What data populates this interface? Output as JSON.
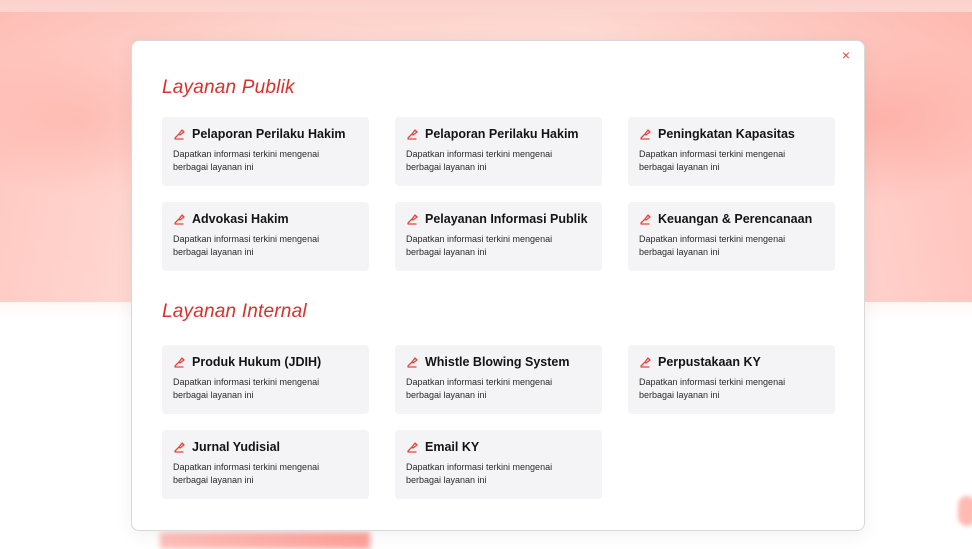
{
  "modal": {
    "close_label": "×",
    "accent_color": "#d8302a"
  },
  "sections": [
    {
      "title": "Layanan Publik",
      "cards": [
        {
          "title": "Pelaporan Perilaku Hakim",
          "desc": "Dapatkan informasi terkini mengenai berbagai layanan ini",
          "icon": "service-icon"
        },
        {
          "title": "Pelaporan Perilaku Hakim",
          "desc": "Dapatkan informasi terkini mengenai berbagai layanan ini",
          "icon": "service-icon"
        },
        {
          "title": "Peningkatan Kapasitas",
          "desc": "Dapatkan informasi terkini mengenai berbagai layanan ini",
          "icon": "service-icon"
        },
        {
          "title": "Advokasi Hakim",
          "desc": "Dapatkan informasi terkini mengenai berbagai layanan ini",
          "icon": "service-icon"
        },
        {
          "title": "Pelayanan Informasi Publik",
          "desc": "Dapatkan informasi terkini mengenai berbagai layanan ini",
          "icon": "service-icon"
        },
        {
          "title": "Keuangan & Perencanaan",
          "desc": "Dapatkan informasi terkini mengenai berbagai layanan ini",
          "icon": "service-icon"
        }
      ]
    },
    {
      "title": "Layanan Internal",
      "cards": [
        {
          "title": "Produk Hukum (JDIH)",
          "desc": "Dapatkan informasi terkini mengenai berbagai layanan ini",
          "icon": "service-icon"
        },
        {
          "title": "Whistle Blowing System",
          "desc": "Dapatkan informasi terkini mengenai berbagai layanan ini",
          "icon": "service-icon"
        },
        {
          "title": "Perpustakaan KY",
          "desc": "Dapatkan informasi terkini mengenai berbagai layanan ini",
          "icon": "service-icon"
        },
        {
          "title": "Jurnal Yudisial",
          "desc": "Dapatkan informasi terkini mengenai berbagai layanan ini",
          "icon": "service-icon"
        },
        {
          "title": "Email KY",
          "desc": "Dapatkan informasi terkini mengenai berbagai layanan ini",
          "icon": "service-icon"
        }
      ]
    }
  ]
}
